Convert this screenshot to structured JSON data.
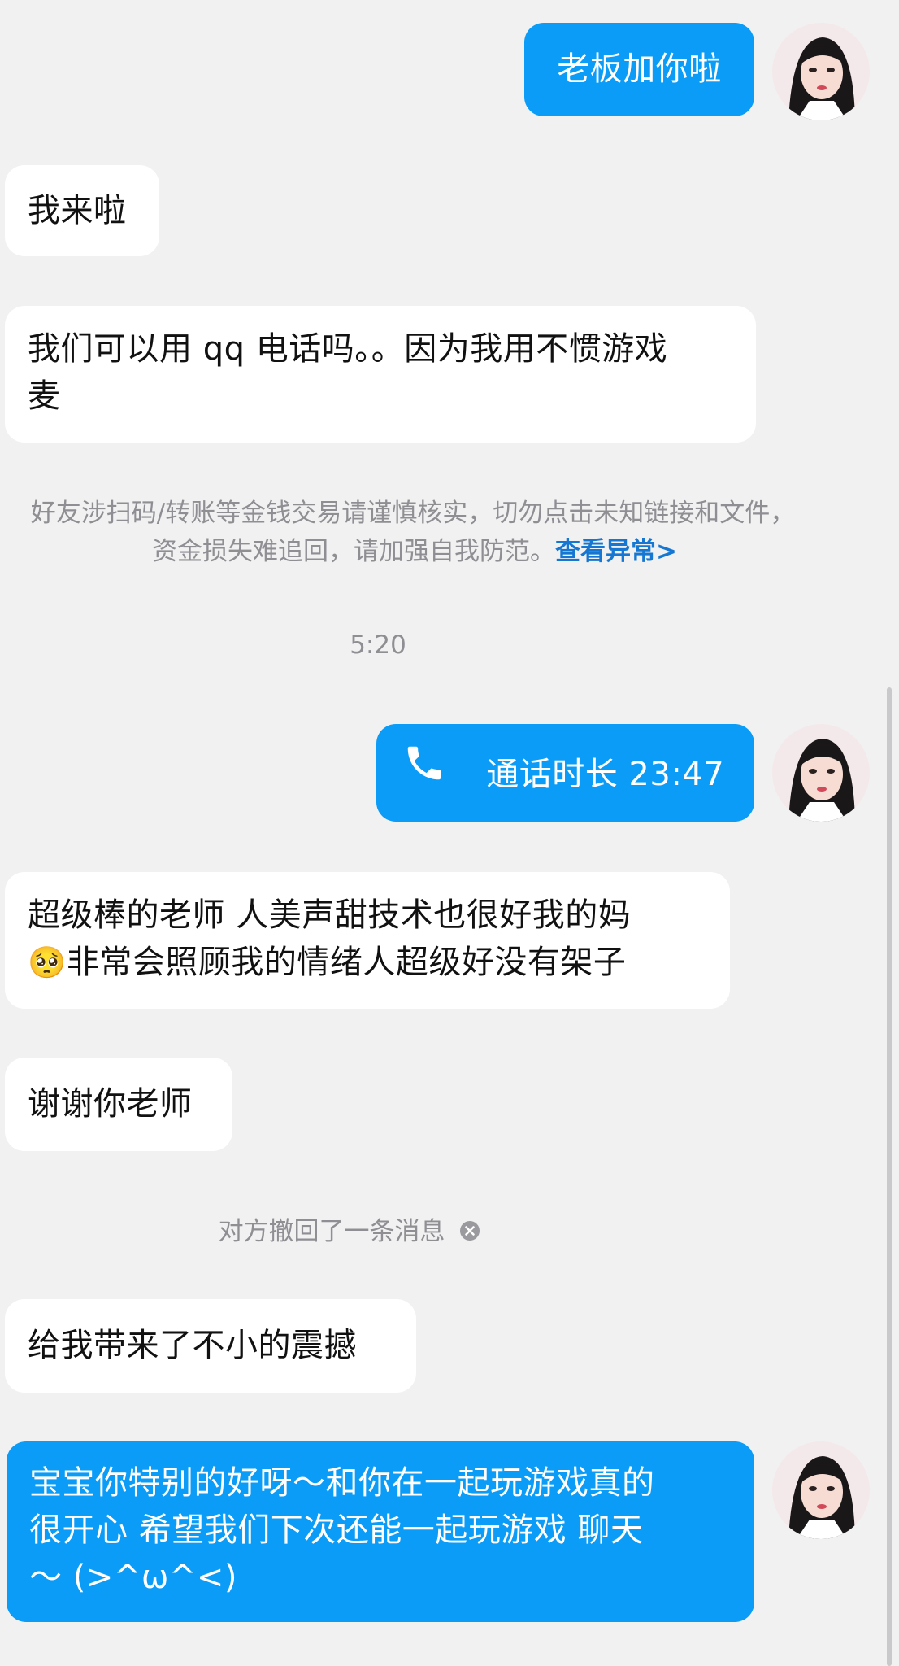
{
  "messages": {
    "m1": "老板加你啦",
    "m2": "我来啦",
    "m3_line1": "我们可以用 qq 电话吗。。因为我用不惯游戏",
    "m3_line2": "麦",
    "notice_line1": "好友涉扫码/转账等金钱交易请谨慎核实，切勿点击未知链接和文件，",
    "notice_line2": "资金损失难追回，请加强自我防范。",
    "notice_link": "查看异常>",
    "timestamp": "5:20",
    "call": "通话时长 23:47",
    "m5_line1": "超级棒的老师 人美声甜技术也很好我的妈",
    "m5_emoji": "🥺",
    "m5_line2": "非常会照顾我的情绪人超级好没有架子",
    "m6": "谢谢你老师",
    "recall": "对方撤回了一条消息",
    "m7": "给我带来了不小的震撼",
    "m8_line1": "宝宝你特别的好呀～和你在一起玩游戏真的",
    "m8_line2": "很开心 希望我们下次还能一起玩游戏 聊天",
    "m8_line3": "～ (>^ω^<)"
  },
  "colors": {
    "outgoing_bubble": "#0a9cf7",
    "incoming_bubble": "#ffffff",
    "background": "#f1f1f2",
    "link": "#1677d2"
  },
  "icons": {
    "call": "phone-icon",
    "recall_close": "close-circle-icon",
    "avatar": "user-avatar"
  }
}
